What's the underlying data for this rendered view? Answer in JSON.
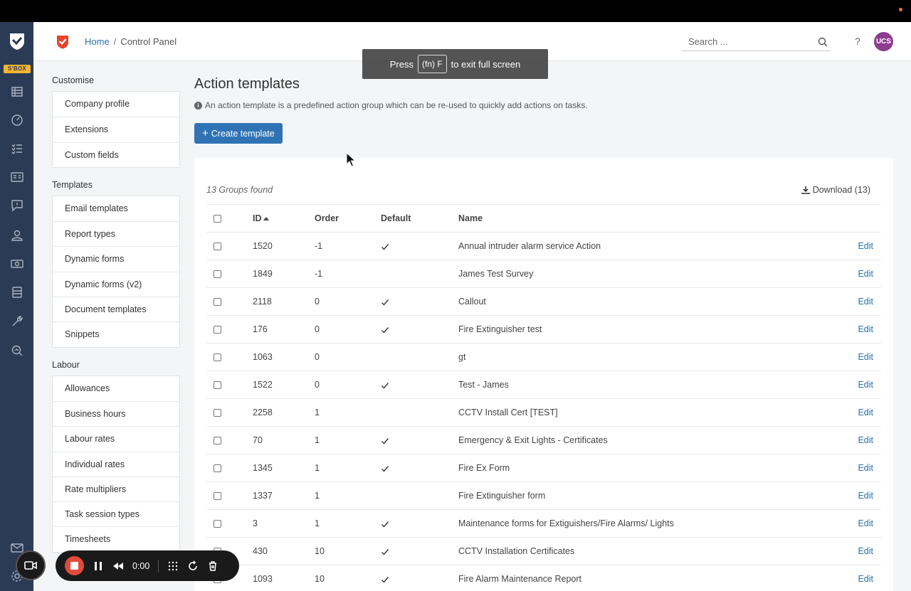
{
  "header": {
    "breadcrumb_home": "Home",
    "breadcrumb_sep": "/",
    "breadcrumb_current": "Control Panel",
    "search_placeholder": "Search ...",
    "help": "?",
    "avatar": "UCS"
  },
  "rail": {
    "badge": "S'BOX"
  },
  "fullscreen_banner": {
    "press": "Press",
    "key": "(fn) F",
    "rest": "to exit full screen"
  },
  "sidenav": {
    "customise_title": "Customise",
    "customise": [
      "Company profile",
      "Extensions",
      "Custom fields"
    ],
    "templates_title": "Templates",
    "templates": [
      "Email templates",
      "Report types",
      "Dynamic forms",
      "Dynamic forms (v2)",
      "Document templates",
      "Snippets"
    ],
    "labour_title": "Labour",
    "labour": [
      "Allowances",
      "Business hours",
      "Labour rates",
      "Individual rates",
      "Rate multipliers",
      "Task session types",
      "Timesheets"
    ]
  },
  "main": {
    "title": "Action templates",
    "description": "An action template is a predefined action group which can be re-used to quickly add actions on tasks.",
    "create_button": "Create template",
    "found": "13 Groups found",
    "download": "Download (13)"
  },
  "table": {
    "headers": {
      "id": "ID",
      "order": "Order",
      "default": "Default",
      "name": "Name"
    },
    "edit_label": "Edit",
    "rows": [
      {
        "id": "1520",
        "order": "-1",
        "default": true,
        "name": "Annual intruder alarm service Action"
      },
      {
        "id": "1849",
        "order": "-1",
        "default": false,
        "name": "James Test Survey"
      },
      {
        "id": "2118",
        "order": "0",
        "default": true,
        "name": "Callout"
      },
      {
        "id": "176",
        "order": "0",
        "default": true,
        "name": "Fire Extinguisher test"
      },
      {
        "id": "1063",
        "order": "0",
        "default": false,
        "name": "gt"
      },
      {
        "id": "1522",
        "order": "0",
        "default": true,
        "name": "Test - James"
      },
      {
        "id": "2258",
        "order": "1",
        "default": false,
        "name": "CCTV Install Cert [TEST]"
      },
      {
        "id": "70",
        "order": "1",
        "default": true,
        "name": "Emergency & Exit Lights - Certificates"
      },
      {
        "id": "1345",
        "order": "1",
        "default": true,
        "name": "Fire Ex Form"
      },
      {
        "id": "1337",
        "order": "1",
        "default": false,
        "name": "Fire Extinguisher form"
      },
      {
        "id": "3",
        "order": "1",
        "default": true,
        "name": "Maintenance forms for Extiguishers/Fire Alarms/ Lights"
      },
      {
        "id": "430",
        "order": "10",
        "default": true,
        "name": "CCTV Installation Certificates"
      },
      {
        "id": "1093",
        "order": "10",
        "default": true,
        "name": "Fire Alarm Maintenance Report"
      }
    ]
  },
  "recorder": {
    "time": "0:00"
  },
  "colors": {
    "rail": "#2b3a55",
    "accent": "#2f73b5",
    "badge": "#f3b531",
    "avatar": "#8c3d8f",
    "record": "#e24a3b"
  }
}
